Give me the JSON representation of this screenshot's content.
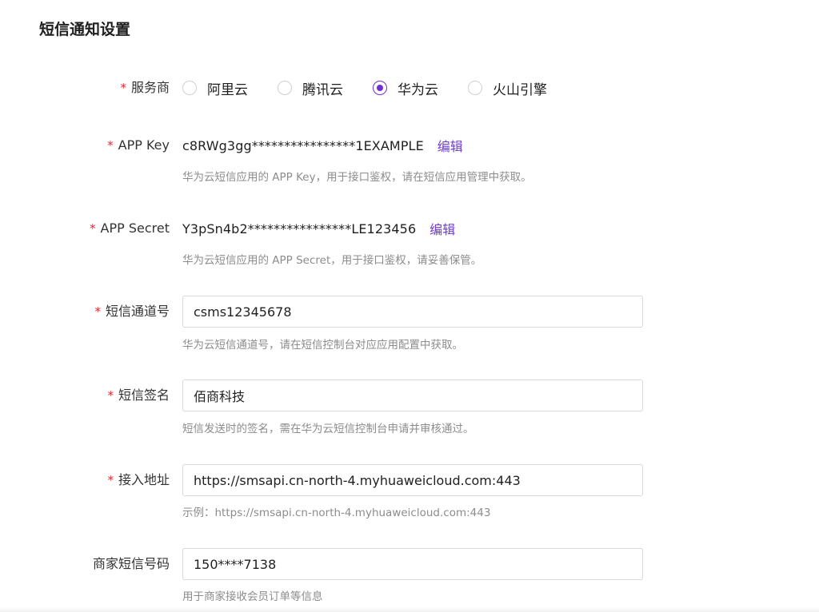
{
  "page": {
    "title": "短信通知设置"
  },
  "provider": {
    "label": "服务商",
    "required": "*",
    "options": [
      {
        "label": "阿里云",
        "checked": false
      },
      {
        "label": "腾讯云",
        "checked": false
      },
      {
        "label": "华为云",
        "checked": true
      },
      {
        "label": "火山引擎",
        "checked": false
      }
    ]
  },
  "app_key": {
    "label": "APP Key",
    "required": "*",
    "value": "c8RWg3gg****************1EXAMPLE",
    "edit_label": "编辑",
    "hint": "华为云短信应用的 APP Key，用于接口鉴权，请在短信应用管理中获取。"
  },
  "app_secret": {
    "label": "APP Secret",
    "required": "*",
    "value": "Y3pSn4b2****************LE123456",
    "edit_label": "编辑",
    "hint": "华为云短信应用的 APP Secret，用于接口鉴权，请妥善保管。"
  },
  "channel": {
    "label": "短信通道号",
    "required": "*",
    "value": "csms12345678",
    "hint": "华为云短信通道号，请在短信控制台对应应用配置中获取。"
  },
  "signature": {
    "label": "短信签名",
    "required": "*",
    "value": "佰商科技",
    "hint": "短信发送时的签名，需在华为云短信控制台申请并审核通过。"
  },
  "endpoint": {
    "label": "接入地址",
    "required": "*",
    "value": "https://smsapi.cn-north-4.myhuaweicloud.com:443",
    "hint": "示例：https://smsapi.cn-north-4.myhuaweicloud.com:443"
  },
  "merchant_phone": {
    "label": "商家短信号码",
    "value": "150****7138",
    "hint": "用于商家接收会员订单等信息"
  },
  "colors": {
    "accent": "#722ed1",
    "link": "#6f3bd1",
    "required": "#f5222d",
    "hint": "#8c8c8c"
  }
}
